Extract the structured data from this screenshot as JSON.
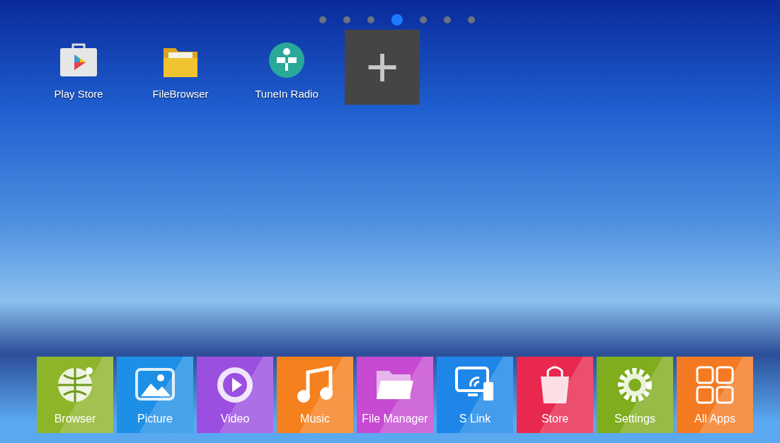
{
  "page_dots": [
    {
      "selected": false
    },
    {
      "selected": false
    },
    {
      "selected": false
    },
    {
      "selected": true
    },
    {
      "selected": false
    },
    {
      "selected": false
    },
    {
      "selected": false
    }
  ],
  "shortcuts": [
    {
      "kind": "play",
      "label": "Play Store"
    },
    {
      "kind": "folder",
      "label": "FileBrowser"
    },
    {
      "kind": "radio",
      "label": "TuneIn Radio"
    }
  ],
  "add_tile": {
    "label": "+"
  },
  "dock": [
    {
      "kind": "browser",
      "label": "Browser",
      "color": "#8db52a"
    },
    {
      "kind": "picture",
      "label": "Picture",
      "color": "#1e8fe6"
    },
    {
      "kind": "video",
      "label": "Video",
      "color": "#9b4fe0"
    },
    {
      "kind": "music",
      "label": "Music",
      "color": "#f5801e"
    },
    {
      "kind": "folder",
      "label": "File Manager",
      "color": "#c64ad2"
    },
    {
      "kind": "slink",
      "label": "S Link",
      "color": "#1d86e8"
    },
    {
      "kind": "store",
      "label": "Store",
      "color": "#e8284e"
    },
    {
      "kind": "settings",
      "label": "Settings",
      "color": "#7fad1e"
    },
    {
      "kind": "apps",
      "label": "All Apps",
      "color": "#f47a22"
    }
  ]
}
